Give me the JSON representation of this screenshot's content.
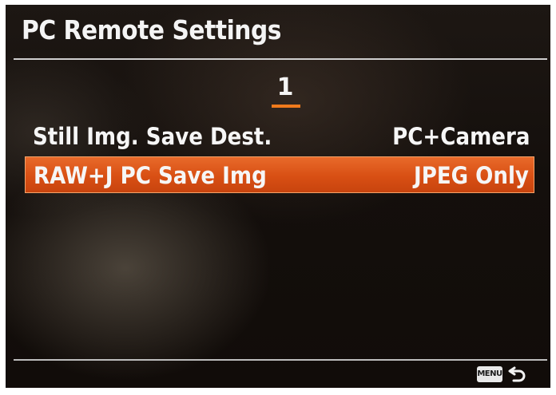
{
  "header": {
    "title": "PC Remote Settings"
  },
  "pagination": {
    "current_page": "1"
  },
  "menu": {
    "items": [
      {
        "label": "Still Img. Save Dest.",
        "value": "PC+Camera",
        "selected": false
      },
      {
        "label": "RAW+J PC Save Img",
        "value": "JPEG Only",
        "selected": true
      }
    ]
  },
  "footer": {
    "menu_button_label": "MENU",
    "back_icon": "return-arrow-icon"
  },
  "colors": {
    "highlight": "#d8521a",
    "accent_underline": "#f07a1c",
    "text": "#f4f4f4"
  }
}
